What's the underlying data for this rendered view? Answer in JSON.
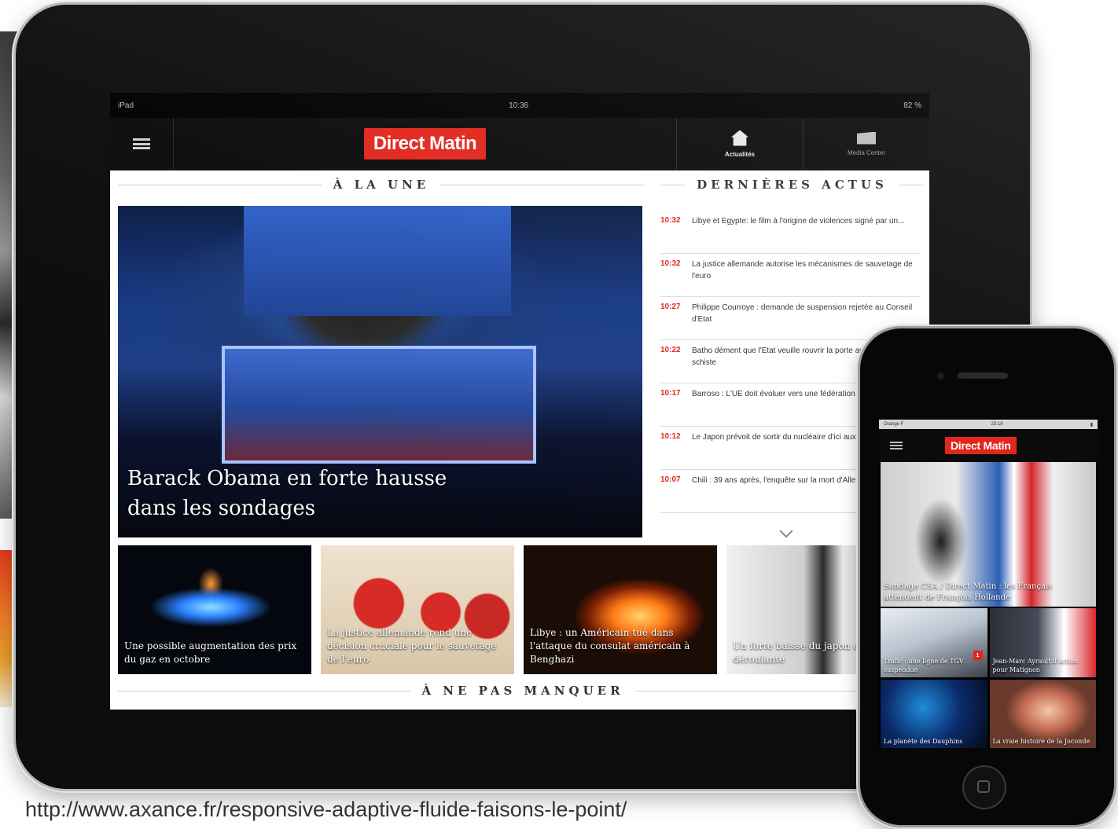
{
  "ipad": {
    "status": {
      "carrier": "iPad",
      "time": "10:36",
      "battery": "82 %"
    },
    "header": {
      "logo": "Direct Matin",
      "tabs": [
        {
          "label": "Actualités",
          "icon": "home-icon",
          "active": true
        },
        {
          "label": "Media Center",
          "icon": "media-center-icon",
          "active": false
        }
      ]
    },
    "sections": {
      "une": "À LA UNE",
      "actus": "DERNIÈRES ACTUS",
      "ne_pas_manquer": "À NE PAS MANQUER"
    },
    "hero": {
      "caption": "Barack Obama en forte hausse dans les sondages"
    },
    "actus": [
      {
        "time": "10:32",
        "text": "Libye et Egypte: le film à l'origine de violences signé par un..."
      },
      {
        "time": "10:32",
        "text": "La justice allemande autorise les mécanismes de sauvetage de l'euro"
      },
      {
        "time": "10:27",
        "text": "Philippe Courroye : demande de suspension rejetée au Conseil d'Etat"
      },
      {
        "time": "10:22",
        "text": "Batho dément que l'Etat veuille rouvrir la porte aux gaz de schiste"
      },
      {
        "time": "10:17",
        "text": "Barroso : L'UE doit évoluer vers une fédération d'Etats-nations"
      },
      {
        "time": "10:12",
        "text": "Le Japon prévoit de sortir du nucléaire d'ici aux années 2030"
      },
      {
        "time": "10:07",
        "text": "Chili : 39 ans après, l'enquête sur la mort d'Allende est close"
      }
    ],
    "thumbs": [
      {
        "caption": "Une possible augmentation des prix du gaz en octobre"
      },
      {
        "caption": "La justice allemande rend une décision cruciale pour le sauvetage de l'euro"
      },
      {
        "caption": "Libye : un Américain tué dans l'attaque du consulat américain à Benghazi"
      },
      {
        "caption": "Un forte baisse du japon et déroulante"
      }
    ]
  },
  "iphone": {
    "status": {
      "carrier": "Orange F",
      "time": "23:18"
    },
    "logo": "Direct Matin",
    "hero": {
      "caption": "Sondage CSA / Direct Matin : les Français attendent de François Hollande"
    },
    "grid": [
      {
        "caption": "Trafic : une ligne de TGV suspendue",
        "badge": "1"
      },
      {
        "caption": "Jean-Marc Ayrault d'action pour Matignon",
        "badge": ""
      },
      {
        "caption": "La planète des Dauphins",
        "badge": ""
      },
      {
        "caption": "La vraie histoire de la Joconde",
        "badge": ""
      }
    ]
  },
  "credit": "http://www.axance.fr/responsive-adaptive-fluide-faisons-le-point/"
}
